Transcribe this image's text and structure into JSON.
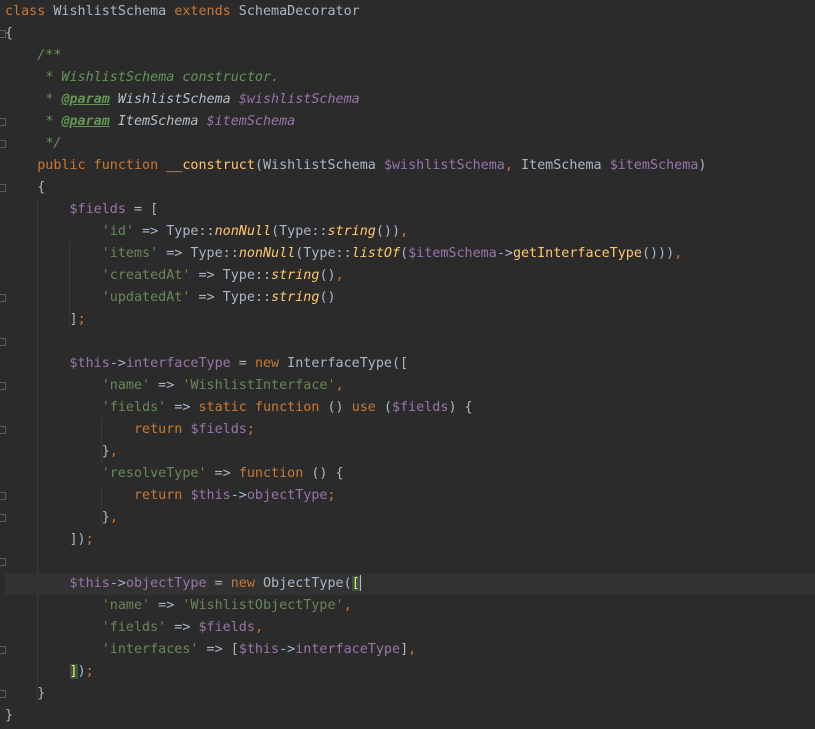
{
  "editor": {
    "language": "PHP",
    "current_line": 27,
    "colors": {
      "background": "#2b2b2b",
      "keyword": "#cc7832",
      "variable": "#9876aa",
      "string": "#6a8759",
      "function": "#ffc66d",
      "comment": "#629755",
      "default": "#a9b7c6"
    },
    "lines": [
      [
        {
          "c": "kw",
          "t": "class"
        },
        {
          "c": "",
          "t": " WishlistSchema "
        },
        {
          "c": "kw",
          "t": "extends"
        },
        {
          "c": "",
          "t": " SchemaDecorator"
        }
      ],
      [
        {
          "c": "",
          "t": "{"
        }
      ],
      [
        {
          "c": "",
          "t": "    "
        },
        {
          "c": "cm",
          "t": "/**"
        }
      ],
      [
        {
          "c": "",
          "t": "     "
        },
        {
          "c": "cm",
          "t": "* WishlistSchema constructor."
        }
      ],
      [
        {
          "c": "",
          "t": "     "
        },
        {
          "c": "cm",
          "t": "* "
        },
        {
          "c": "tag",
          "t": "@param"
        },
        {
          "c": "ctyp",
          "t": " WishlistSchema "
        },
        {
          "c": "cvar",
          "t": "$wishlistSchema"
        }
      ],
      [
        {
          "c": "",
          "t": "     "
        },
        {
          "c": "cm",
          "t": "* "
        },
        {
          "c": "tag",
          "t": "@param"
        },
        {
          "c": "ctyp",
          "t": " ItemSchema "
        },
        {
          "c": "cvar",
          "t": "$itemSchema"
        }
      ],
      [
        {
          "c": "",
          "t": "     "
        },
        {
          "c": "cm",
          "t": "*/"
        }
      ],
      [
        {
          "c": "",
          "t": "    "
        },
        {
          "c": "kw",
          "t": "public function"
        },
        {
          "c": "",
          "t": " "
        },
        {
          "c": "fn",
          "t": "__construct"
        },
        {
          "c": "",
          "t": "(WishlistSchema "
        },
        {
          "c": "var",
          "t": "$wishlistSchema"
        },
        {
          "c": "kw",
          "t": ", "
        },
        {
          "c": "",
          "t": "ItemSchema "
        },
        {
          "c": "var",
          "t": "$itemSchema"
        },
        {
          "c": "",
          "t": ")"
        }
      ],
      [
        {
          "c": "",
          "t": "    {"
        }
      ],
      [
        {
          "c": "",
          "t": "        "
        },
        {
          "c": "var",
          "t": "$fields"
        },
        {
          "c": "",
          "t": " = ["
        }
      ],
      [
        {
          "c": "",
          "t": "            "
        },
        {
          "c": "str",
          "t": "'id'"
        },
        {
          "c": "",
          "t": " => Type::"
        },
        {
          "c": "ifn",
          "t": "nonNull"
        },
        {
          "c": "",
          "t": "(Type::"
        },
        {
          "c": "ifn",
          "t": "string"
        },
        {
          "c": "",
          "t": "())"
        },
        {
          "c": "kw",
          "t": ","
        }
      ],
      [
        {
          "c": "",
          "t": "            "
        },
        {
          "c": "str",
          "t": "'items'"
        },
        {
          "c": "",
          "t": " => Type::"
        },
        {
          "c": "ifn",
          "t": "nonNull"
        },
        {
          "c": "",
          "t": "(Type::"
        },
        {
          "c": "ifn",
          "t": "listOf"
        },
        {
          "c": "",
          "t": "("
        },
        {
          "c": "var",
          "t": "$itemSchema"
        },
        {
          "c": "",
          "t": "->"
        },
        {
          "c": "fn",
          "t": "getInterfaceType"
        },
        {
          "c": "",
          "t": "()))"
        },
        {
          "c": "kw",
          "t": ","
        }
      ],
      [
        {
          "c": "",
          "t": "            "
        },
        {
          "c": "str",
          "t": "'createdAt'"
        },
        {
          "c": "",
          "t": " => Type::"
        },
        {
          "c": "ifn",
          "t": "string"
        },
        {
          "c": "",
          "t": "()"
        },
        {
          "c": "kw",
          "t": ","
        }
      ],
      [
        {
          "c": "",
          "t": "            "
        },
        {
          "c": "str",
          "t": "'updatedAt'"
        },
        {
          "c": "",
          "t": " => Type::"
        },
        {
          "c": "ifn",
          "t": "string"
        },
        {
          "c": "",
          "t": "()"
        }
      ],
      [
        {
          "c": "",
          "t": "        ]"
        },
        {
          "c": "kw",
          "t": ";"
        }
      ],
      [
        {
          "c": "",
          "t": ""
        }
      ],
      [
        {
          "c": "",
          "t": "        "
        },
        {
          "c": "var",
          "t": "$this"
        },
        {
          "c": "",
          "t": "->"
        },
        {
          "c": "var",
          "t": "interfaceType"
        },
        {
          "c": "",
          "t": " = "
        },
        {
          "c": "kw",
          "t": "new"
        },
        {
          "c": "",
          "t": " InterfaceType(["
        }
      ],
      [
        {
          "c": "",
          "t": "            "
        },
        {
          "c": "str",
          "t": "'name'"
        },
        {
          "c": "",
          "t": " => "
        },
        {
          "c": "str",
          "t": "'WishlistInterface'"
        },
        {
          "c": "kw",
          "t": ","
        }
      ],
      [
        {
          "c": "",
          "t": "            "
        },
        {
          "c": "str",
          "t": "'fields'"
        },
        {
          "c": "",
          "t": " => "
        },
        {
          "c": "kw",
          "t": "static function"
        },
        {
          "c": "",
          "t": " () "
        },
        {
          "c": "kw",
          "t": "use"
        },
        {
          "c": "",
          "t": " ("
        },
        {
          "c": "var",
          "t": "$fields"
        },
        {
          "c": "",
          "t": ") {"
        }
      ],
      [
        {
          "c": "",
          "t": "                "
        },
        {
          "c": "kw",
          "t": "return"
        },
        {
          "c": "",
          "t": " "
        },
        {
          "c": "var",
          "t": "$fields"
        },
        {
          "c": "kw",
          "t": ";"
        }
      ],
      [
        {
          "c": "",
          "t": "            }"
        },
        {
          "c": "kw",
          "t": ","
        }
      ],
      [
        {
          "c": "",
          "t": "            "
        },
        {
          "c": "str",
          "t": "'resolveType'"
        },
        {
          "c": "",
          "t": " => "
        },
        {
          "c": "kw",
          "t": "function"
        },
        {
          "c": "",
          "t": " () {"
        }
      ],
      [
        {
          "c": "",
          "t": "                "
        },
        {
          "c": "kw",
          "t": "return"
        },
        {
          "c": "",
          "t": " "
        },
        {
          "c": "var",
          "t": "$this"
        },
        {
          "c": "",
          "t": "->"
        },
        {
          "c": "var",
          "t": "objectType"
        },
        {
          "c": "kw",
          "t": ";"
        }
      ],
      [
        {
          "c": "",
          "t": "            }"
        },
        {
          "c": "kw",
          "t": ","
        }
      ],
      [
        {
          "c": "",
          "t": "        ])"
        },
        {
          "c": "kw",
          "t": ";"
        }
      ],
      [
        {
          "c": "",
          "t": ""
        }
      ],
      [
        {
          "c": "",
          "t": "        "
        },
        {
          "c": "var",
          "t": "$this"
        },
        {
          "c": "",
          "t": "->"
        },
        {
          "c": "var",
          "t": "objectType"
        },
        {
          "c": "",
          "t": " = "
        },
        {
          "c": "kw",
          "t": "new"
        },
        {
          "c": "",
          "t": " ObjectType("
        },
        {
          "c": "bryel",
          "t": "["
        },
        {
          "c": "caret",
          "t": ""
        }
      ],
      [
        {
          "c": "",
          "t": "            "
        },
        {
          "c": "str",
          "t": "'name'"
        },
        {
          "c": "",
          "t": " => "
        },
        {
          "c": "str",
          "t": "'WishlistObjectType'"
        },
        {
          "c": "kw",
          "t": ","
        }
      ],
      [
        {
          "c": "",
          "t": "            "
        },
        {
          "c": "str",
          "t": "'fields'"
        },
        {
          "c": "",
          "t": " => "
        },
        {
          "c": "var",
          "t": "$fields"
        },
        {
          "c": "kw",
          "t": ","
        }
      ],
      [
        {
          "c": "",
          "t": "            "
        },
        {
          "c": "str",
          "t": "'interfaces'"
        },
        {
          "c": "",
          "t": " => ["
        },
        {
          "c": "var",
          "t": "$this"
        },
        {
          "c": "",
          "t": "->"
        },
        {
          "c": "var",
          "t": "interfaceType"
        },
        {
          "c": "",
          "t": "]"
        },
        {
          "c": "kw",
          "t": ","
        }
      ],
      [
        {
          "c": "",
          "t": "        "
        },
        {
          "c": "bryel",
          "t": "]"
        },
        {
          "c": "",
          "t": ")"
        },
        {
          "c": "kw",
          "t": ";"
        }
      ],
      [
        {
          "c": "",
          "t": "    }"
        }
      ],
      [
        {
          "c": "",
          "t": "}"
        }
      ]
    ],
    "fold_markers": [
      2,
      6,
      7,
      9,
      14,
      16,
      18,
      20,
      23,
      24,
      26,
      30,
      32
    ]
  }
}
